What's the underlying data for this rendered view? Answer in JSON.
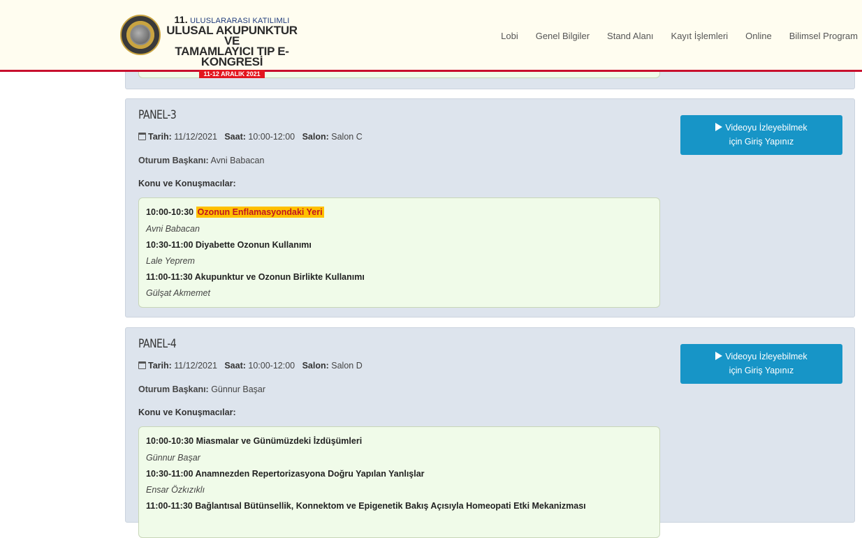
{
  "header": {
    "logo": {
      "number": "11.",
      "line1": "ULUSLARARASI KATILIMLI",
      "line2": "ULUSAL AKUPUNKTUR VE",
      "line3": "TAMAMLAYICI TIP E-KONGRESİ",
      "date": "11-12 ARALIK 2021"
    },
    "nav": [
      "Lobi",
      "Genel Bilgiler",
      "Stand Alanı",
      "Kayıt İşlemleri",
      "Online",
      "Bilimsel Program"
    ]
  },
  "labels": {
    "date": "Tarih:",
    "time": "Saat:",
    "hall": "Salon:",
    "chair": "Oturum Başkanı:",
    "topics": "Konu ve Konuşmacılar:",
    "video_line1": "Videoyu İzleyebilmek",
    "video_line2": "için Giriş Yapınız"
  },
  "panels": [
    {
      "title": "PANEL-3",
      "date": "11/12/2021",
      "time": "10:00-12:00",
      "hall": "Salon C",
      "chair": "Avni Babacan",
      "talks": [
        {
          "time": "10:00-10:30",
          "title": "Ozonun Enflamasyondaki Yeri",
          "speaker": "Avni Babacan",
          "highlighted": true
        },
        {
          "time": "10:30-11:00",
          "title": "Diyabette Ozonun Kullanımı",
          "speaker": "Lale Yeprem"
        },
        {
          "time": "11:00-11:30",
          "title": "Akupunktur ve Ozonun Birlikte Kullanımı",
          "speaker": "Gülşat Akmemet"
        }
      ]
    },
    {
      "title": "PANEL-4",
      "date": "11/12/2021",
      "time": "10:00-12:00",
      "hall": "Salon D",
      "chair": "Günnur Başar",
      "talks": [
        {
          "time": "10:00-10:30",
          "title": "Miasmalar ve Günümüzdeki İzdüşümleri",
          "speaker": "Günnur Başar"
        },
        {
          "time": "10:30-11:00",
          "title": "Anamnezden Repertorizasyona Doğru Yapılan Yanlışlar",
          "speaker": "Ensar Özkızıklı"
        },
        {
          "time": "11:00-11:30",
          "title": "Bağlantısal Bütünsellik, Konnektom ve Epigenetik Bakış Açısıyla Homeopati Etki Mekanizması",
          "speaker": ""
        }
      ]
    }
  ],
  "colors": {
    "header_bg": "#fffdf0",
    "header_border": "#c8102e",
    "panel_bg": "#dde4ed",
    "talk_box_bg": "#f0fbe9",
    "button_bg": "#1795c7",
    "highlight_bg": "#ffc000",
    "highlight_text": "#c0161f"
  },
  "icons": {
    "calendar": "calendar-icon",
    "play": "play-icon"
  }
}
